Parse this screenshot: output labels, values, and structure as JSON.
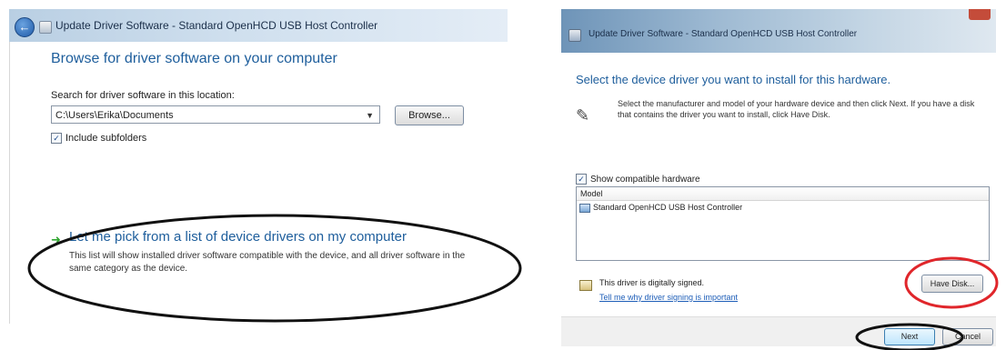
{
  "left_window": {
    "title": "Update Driver Software - Standard OpenHCD USB Host Controller",
    "heading": "Browse for driver software on your computer",
    "search_label": "Search for driver software in this location:",
    "path_value": "C:\\Users\\Erika\\Documents",
    "browse_label": "Browse...",
    "include_subfolders_label": "Include subfolders",
    "include_subfolders_checked": true,
    "pick_option_title": "Let me pick from a list of device drivers on my computer",
    "pick_option_desc": "This list will show installed driver software compatible with the device, and all driver software in the same category as the device."
  },
  "right_window": {
    "title": "Update Driver Software - Standard OpenHCD USB Host Controller",
    "heading": "Select the device driver you want to install for this hardware.",
    "instructions": "Select the manufacturer and model of your hardware device and then click Next. If you have a disk that contains the driver you want to install, click Have Disk.",
    "show_compatible_label": "Show compatible hardware",
    "show_compatible_checked": true,
    "model_header": "Model",
    "models": [
      "Standard OpenHCD USB Host Controller"
    ],
    "signed_text": "This driver is digitally signed.",
    "signing_link": "Tell me why driver signing is important",
    "have_disk_label": "Have Disk...",
    "next_label": "Next",
    "cancel_label": "Cancel"
  },
  "annotations": {
    "black_ellipse_color": "#111111",
    "red_ellipse_color": "#e0262b"
  },
  "colors": {
    "heading_blue": "#1e5e9c",
    "link_blue": "#1e5eb8",
    "green_arrow": "#2fa52f"
  }
}
